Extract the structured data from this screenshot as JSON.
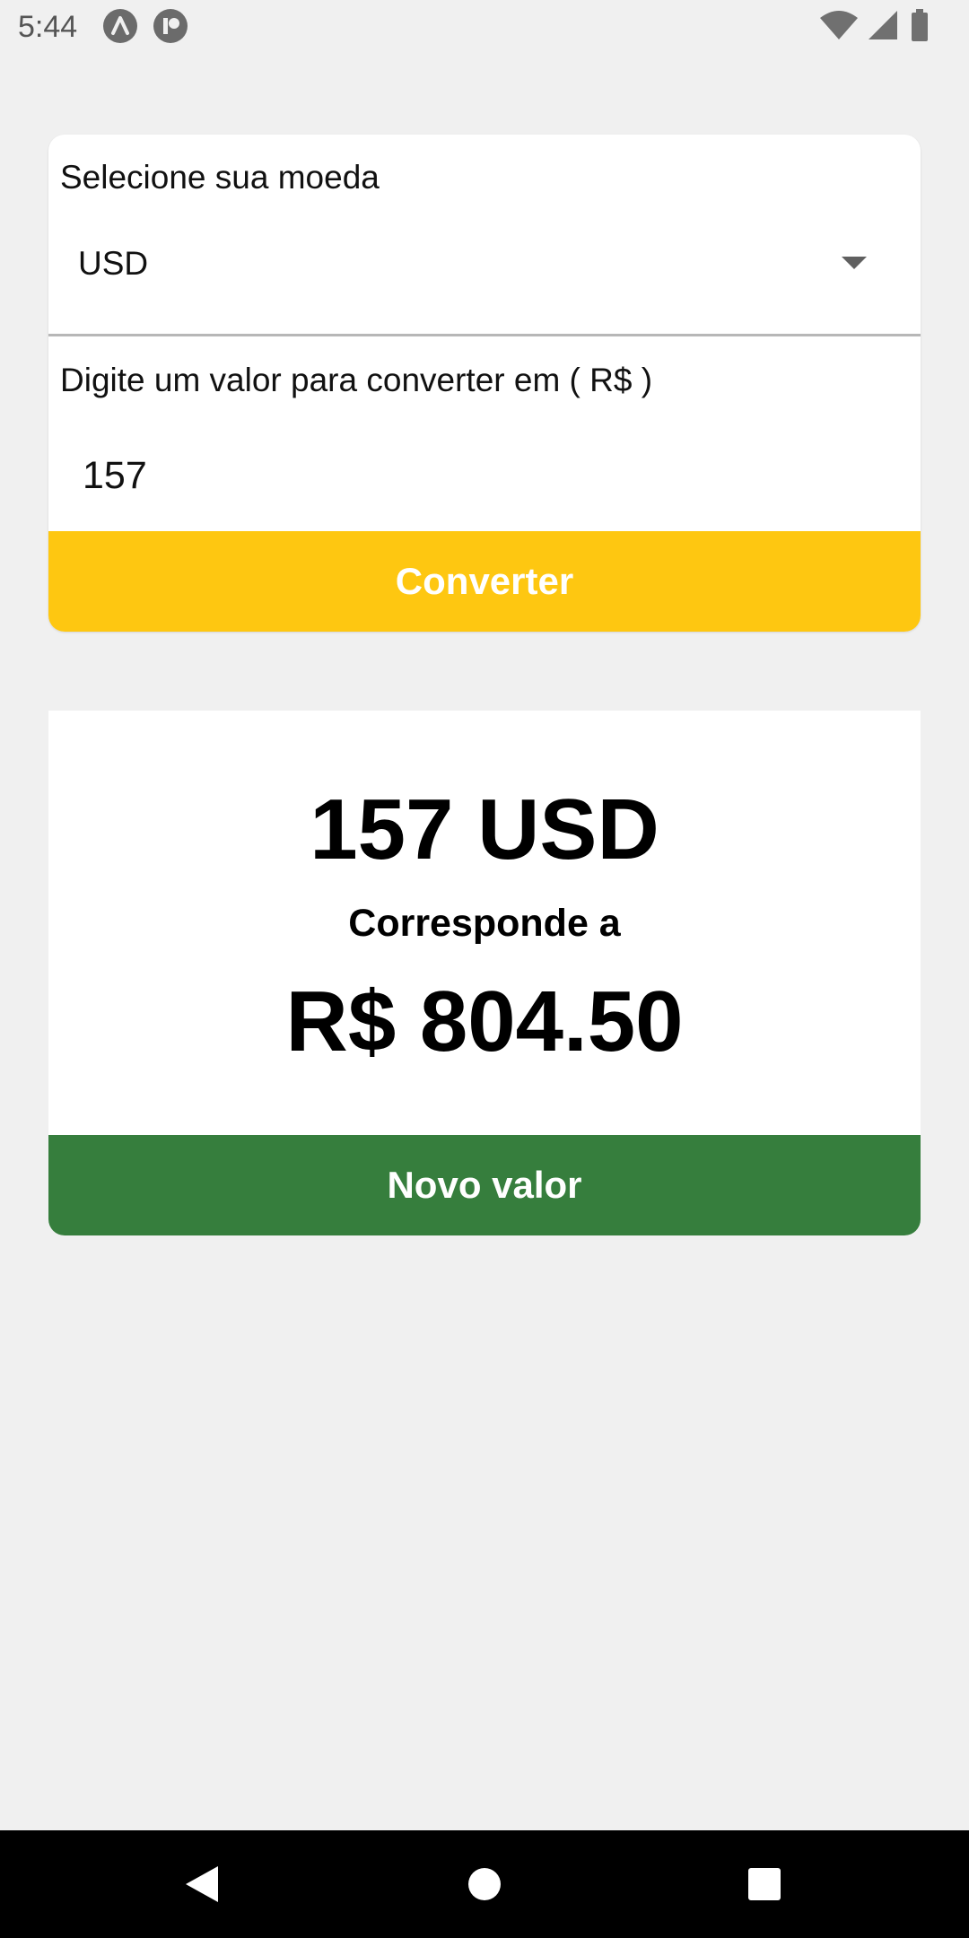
{
  "status_bar": {
    "time": "5:44",
    "icons": [
      "app-notification-icon",
      "app-notification-icon",
      "wifi-icon",
      "signal-icon",
      "battery-icon"
    ]
  },
  "converter": {
    "currency_label": "Selecione sua moeda",
    "currency_selected": "USD",
    "amount_label": "Digite um valor para converter em ( R$ )",
    "amount_value": "157",
    "convert_button": "Converter",
    "accent_color": "#fec711"
  },
  "result": {
    "amount": "157 USD",
    "caption": "Corresponde a",
    "value": "R$ 804.50",
    "new_value_button": "Novo valor",
    "button_color": "#367e3d"
  },
  "nav_bar": {
    "buttons": [
      "back-icon",
      "home-icon",
      "recents-icon"
    ]
  }
}
